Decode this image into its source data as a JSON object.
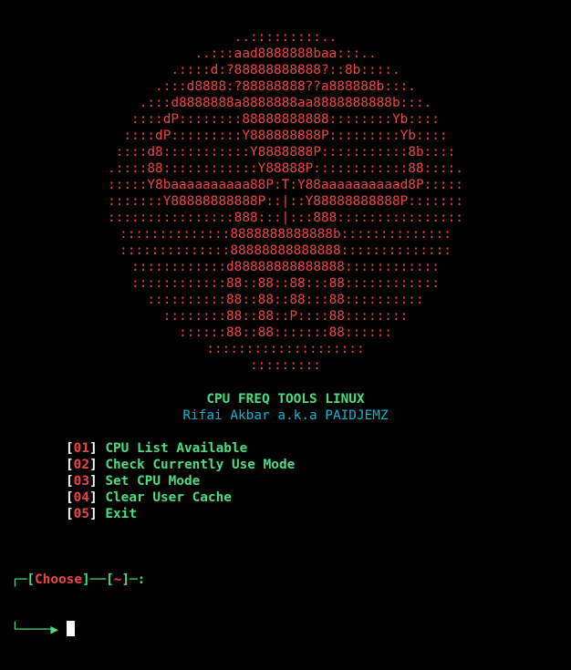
{
  "banner": {
    "art_lines": [
      "..:::::::::..",
      "..:::aad8888888baa:::..",
      ".::::d:?88888888888?::8b::::.",
      ".:::d8888:?88888888??a888888b:::.",
      ".:::d8888888a8888888aa8888888888b:::.",
      "::::dP::::::::88888888888::::::::Yb::::",
      "::::dP:::::::::Y888888888P:::::::::Yb::::",
      "::::d8:::::::::::Y8888888P:::::::::::8b::::",
      ".::::88::::::::::::Y88888P::::::::::::88::::.",
      ":::::Y8baaaaaaaaaa88P:T:Y88aaaaaaaaaad8P:::::",
      ":::::::Y88888888888P::|::Y88888888888P:::::::",
      "::::::::::::::::888:::|:::888::::::::::::::::",
      "::::::::::::::8888888888888b::::::::::::::",
      "::::::::::::::88888888888888::::::::::::::",
      "::::::::::::d88888888888888::::::::::::",
      "::::::::::::88::88::88:::88::::::::::::",
      "::::::::::88::88::88:::88::::::::::",
      "::::::::88::88::P::::88::::::::",
      "::::::88::88:::::::88::::::",
      "::::::::::::::::::::",
      ":::::::::"
    ]
  },
  "header": {
    "title": "CPU FREQ TOOLS LINUX",
    "author": "Rifai Akbar a.k.a PAIDJEMZ"
  },
  "menu": {
    "items": [
      {
        "open": "[",
        "number": "01",
        "close": "]",
        "label": "CPU List Available"
      },
      {
        "open": "[",
        "number": "02",
        "close": "]",
        "label": "Check Currently Use Mode"
      },
      {
        "open": "[",
        "number": "03",
        "close": "]",
        "label": "Set CPU Mode"
      },
      {
        "open": "[",
        "number": "04",
        "close": "]",
        "label": "Clear User Cache"
      },
      {
        "open": "[",
        "number": "05",
        "close": "]",
        "label": "Exit"
      }
    ]
  },
  "prompt": {
    "corner_top": "┌─",
    "open": "[",
    "label": "Choose",
    "close": "]",
    "dash": "──",
    "open2": "[",
    "dir": "~",
    "close2": "]",
    "tail": "─:",
    "corner_bottom": "└────▶ "
  },
  "colors": {
    "background": "#000000",
    "art": "#ef4444",
    "title": "#4ade80",
    "author": "#06b6d4",
    "menu_number": "#ef4444",
    "menu_label": "#4ade80",
    "bracket": "#ffffff"
  }
}
